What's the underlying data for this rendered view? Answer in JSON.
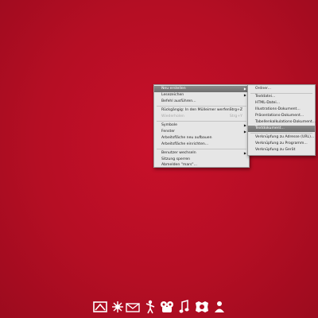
{
  "main_menu": {
    "items": [
      {
        "label": "Neu erstellen",
        "arrow": "▶"
      },
      {
        "label": "Lesezeichen",
        "arrow": "▶"
      },
      {
        "label": "Befehl ausführen..."
      },
      {
        "label": "Rückgängig: In den Mülleimer werfen",
        "shortcut": "Strg+Z"
      },
      {
        "label": "Wiederholen",
        "shortcut": "Strg+Y"
      },
      {
        "label": "Symbole",
        "arrow": "▶"
      },
      {
        "label": "Fenster",
        "arrow": "▶"
      },
      {
        "label": "Arbeitsfläche neu aufbauen"
      },
      {
        "label": "Arbeitsfläche einrichten..."
      },
      {
        "label": "Benutzer wechseln",
        "arrow": "▶"
      },
      {
        "label": "Sitzung sperren"
      },
      {
        "label": "Abmelden \"mars\"..."
      }
    ]
  },
  "sub_menu": {
    "items": [
      {
        "label": "Ordner..."
      },
      {
        "label": "Textdatei..."
      },
      {
        "label": "HTML-Datei..."
      },
      {
        "label": "Illustrations-Dokument..."
      },
      {
        "label": "Präsentations-Dokument..."
      },
      {
        "label": "Tabellenkalkulations-Dokument..."
      },
      {
        "label": "Textdokument..."
      },
      {
        "label": "Verknüpfung zu Adresse (URL)..."
      },
      {
        "label": "Verknüpfung zu Programm..."
      },
      {
        "label": "Verknüpfung zu Gerät"
      }
    ]
  },
  "dock": {
    "icons": [
      "home-icon",
      "settings-icon",
      "mail-icon",
      "person-icon",
      "people-icon",
      "music-icon",
      "photo-icon",
      "user-icon"
    ]
  }
}
